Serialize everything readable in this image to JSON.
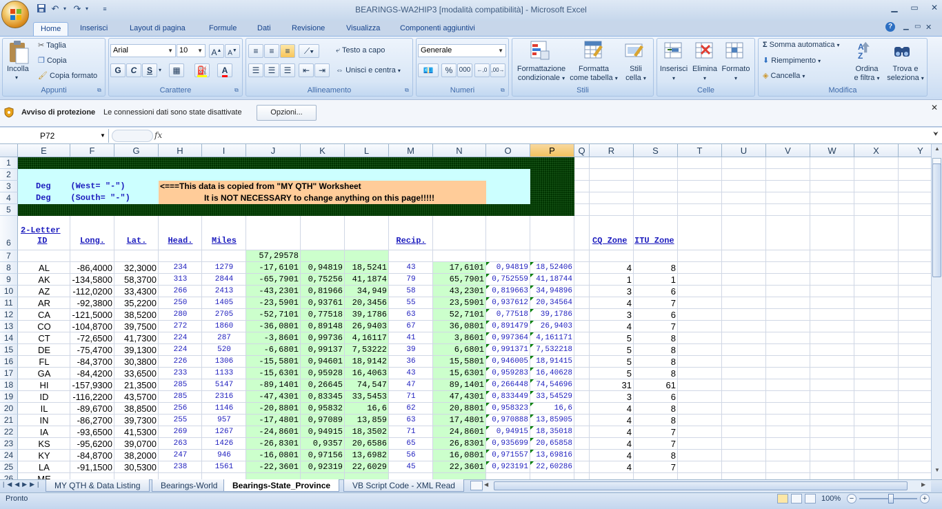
{
  "app": {
    "title": "BEARINGS-WA2HIP3  [modalità compatibilità] - Microsoft Excel"
  },
  "ribbon": {
    "tabs": [
      "Home",
      "Inserisci",
      "Layout di pagina",
      "Formule",
      "Dati",
      "Revisione",
      "Visualizza",
      "Componenti aggiuntivi"
    ],
    "clipboard": {
      "paste": "Incolla",
      "cut": "Taglia",
      "copy": "Copia",
      "format_painter": "Copia formato",
      "label": "Appunti"
    },
    "font": {
      "name": "Arial",
      "size": "10",
      "label": "Carattere",
      "bold": "G",
      "italic": "C",
      "underline": "S"
    },
    "alignment": {
      "wrap": "Testo a capo",
      "merge": "Unisci e centra",
      "label": "Allineamento"
    },
    "number": {
      "format": "Generale",
      "label": "Numeri",
      "percent": "%",
      "thousands": "000"
    },
    "styles": {
      "conditional_1": "Formattazione",
      "conditional_2": "condizionale",
      "table_1": "Formatta",
      "table_2": "come tabella",
      "cell_1": "Stili",
      "cell_2": "cella",
      "label": "Stili"
    },
    "cells": {
      "insert": "Inserisci",
      "delete": "Elimina",
      "format": "Formato",
      "label": "Celle"
    },
    "editing": {
      "autosum": "Somma automatica",
      "fill": "Riempimento",
      "clear": "Cancella",
      "sort_1": "Ordina",
      "sort_2": "e filtra",
      "find_1": "Trova e",
      "find_2": "seleziona",
      "label": "Modifica"
    }
  },
  "security_bar": {
    "title": "Avviso di protezione",
    "message": "Le connessioni dati sono state disattivate",
    "button": "Opzioni..."
  },
  "formula_bar": {
    "name_box": "P72",
    "fx": "fx"
  },
  "columns": [
    "E",
    "F",
    "G",
    "H",
    "I",
    "J",
    "K",
    "L",
    "M",
    "N",
    "O",
    "P",
    "Q",
    "R",
    "S",
    "T",
    "U",
    "V",
    "W",
    "X",
    "Y"
  ],
  "rows": [
    "1",
    "2",
    "3",
    "4",
    "5",
    "6",
    "7",
    "8",
    "9",
    "10",
    "11",
    "12",
    "13",
    "14",
    "15",
    "16",
    "17",
    "18",
    "19",
    "20",
    "21",
    "22",
    "23",
    "24",
    "25",
    "26"
  ],
  "banner": {
    "deg_west": "Deg    (West= \"-\")",
    "deg_south": "Deg    (South= \"-\")",
    "note_1": "<===This data is copied from \"MY QTH\" Worksheet",
    "note_2": "It is NOT NECESSARY to change anything on this page!!!!!"
  },
  "headers": {
    "id_1": "2-Letter",
    "id_2": "ID",
    "long": "Long.",
    "lat": "Lat.",
    "head": "Head.",
    "miles": "Miles",
    "recip": "Recip.",
    "cq": "CQ Zone",
    "itu": "ITU Zone"
  },
  "row7_j": "57,29578",
  "data_rows": [
    {
      "id": "AL",
      "long": "-86,4000",
      "lat": "32,3000",
      "head": "234",
      "miles": "1279",
      "j": "-17,6101",
      "k": "0,94819",
      "l": "18,5241",
      "m": "43",
      "n": "17,6101",
      "o": "0,94819",
      "p": "18,52406",
      "r": "4",
      "s": "8"
    },
    {
      "id": "AK",
      "long": "-134,5800",
      "lat": "58,3700",
      "head": "313",
      "miles": "2844",
      "j": "-65,7901",
      "k": "0,75256",
      "l": "41,1874",
      "m": "79",
      "n": "65,7901",
      "o": "0,752559",
      "p": "41,18744",
      "r": "1",
      "s": "1"
    },
    {
      "id": "AZ",
      "long": "-112,0200",
      "lat": "33,4300",
      "head": "266",
      "miles": "2413",
      "j": "-43,2301",
      "k": "0,81966",
      "l": "34,949",
      "m": "58",
      "n": "43,2301",
      "o": "0,819663",
      "p": "34,94896",
      "r": "3",
      "s": "6"
    },
    {
      "id": "AR",
      "long": "-92,3800",
      "lat": "35,2200",
      "head": "250",
      "miles": "1405",
      "j": "-23,5901",
      "k": "0,93761",
      "l": "20,3456",
      "m": "55",
      "n": "23,5901",
      "o": "0,937612",
      "p": "20,34564",
      "r": "4",
      "s": "7"
    },
    {
      "id": "CA",
      "long": "-121,5000",
      "lat": "38,5200",
      "head": "280",
      "miles": "2705",
      "j": "-52,7101",
      "k": "0,77518",
      "l": "39,1786",
      "m": "63",
      "n": "52,7101",
      "o": "0,77518",
      "p": "39,1786",
      "r": "3",
      "s": "6"
    },
    {
      "id": "CO",
      "long": "-104,8700",
      "lat": "39,7500",
      "head": "272",
      "miles": "1860",
      "j": "-36,0801",
      "k": "0,89148",
      "l": "26,9403",
      "m": "67",
      "n": "36,0801",
      "o": "0,891479",
      "p": "26,9403",
      "r": "4",
      "s": "7"
    },
    {
      "id": "CT",
      "long": "-72,6500",
      "lat": "41,7300",
      "head": "224",
      "miles": "287",
      "j": "-3,8601",
      "k": "0,99736",
      "l": "4,16117",
      "m": "41",
      "n": "3,8601",
      "o": "0,997364",
      "p": "4,161171",
      "r": "5",
      "s": "8"
    },
    {
      "id": "DE",
      "long": "-75,4700",
      "lat": "39,1300",
      "head": "224",
      "miles": "520",
      "j": "-6,6801",
      "k": "0,99137",
      "l": "7,53222",
      "m": "39",
      "n": "6,6801",
      "o": "0,991371",
      "p": "7,532218",
      "r": "5",
      "s": "8"
    },
    {
      "id": "FL",
      "long": "-84,3700",
      "lat": "30,3800",
      "head": "226",
      "miles": "1306",
      "j": "-15,5801",
      "k": "0,94601",
      "l": "18,9142",
      "m": "36",
      "n": "15,5801",
      "o": "0,946005",
      "p": "18,91415",
      "r": "5",
      "s": "8"
    },
    {
      "id": "GA",
      "long": "-84,4200",
      "lat": "33,6500",
      "head": "233",
      "miles": "1133",
      "j": "-15,6301",
      "k": "0,95928",
      "l": "16,4063",
      "m": "43",
      "n": "15,6301",
      "o": "0,959283",
      "p": "16,40628",
      "r": "5",
      "s": "8"
    },
    {
      "id": "HI",
      "long": "-157,9300",
      "lat": "21,3500",
      "head": "285",
      "miles": "5147",
      "j": "-89,1401",
      "k": "0,26645",
      "l": "74,547",
      "m": "47",
      "n": "89,1401",
      "o": "0,266448",
      "p": "74,54696",
      "r": "31",
      "s": "61"
    },
    {
      "id": "ID",
      "long": "-116,2200",
      "lat": "43,5700",
      "head": "285",
      "miles": "2316",
      "j": "-47,4301",
      "k": "0,83345",
      "l": "33,5453",
      "m": "71",
      "n": "47,4301",
      "o": "0,833449",
      "p": "33,54529",
      "r": "3",
      "s": "6"
    },
    {
      "id": "IL",
      "long": "-89,6700",
      "lat": "38,8500",
      "head": "256",
      "miles": "1146",
      "j": "-20,8801",
      "k": "0,95832",
      "l": "16,6",
      "m": "62",
      "n": "20,8801",
      "o": "0,958323",
      "p": "16,6",
      "r": "4",
      "s": "8"
    },
    {
      "id": "IN",
      "long": "-86,2700",
      "lat": "39,7300",
      "head": "255",
      "miles": "957",
      "j": "-17,4801",
      "k": "0,97089",
      "l": "13,859",
      "m": "63",
      "n": "17,4801",
      "o": "0,970888",
      "p": "13,85905",
      "r": "4",
      "s": "8"
    },
    {
      "id": "IA",
      "long": "-93,6500",
      "lat": "41,5300",
      "head": "269",
      "miles": "1267",
      "j": "-24,8601",
      "k": "0,94915",
      "l": "18,3502",
      "m": "71",
      "n": "24,8601",
      "o": "0,94915",
      "p": "18,35018",
      "r": "4",
      "s": "7"
    },
    {
      "id": "KS",
      "long": "-95,6200",
      "lat": "39,0700",
      "head": "263",
      "miles": "1426",
      "j": "-26,8301",
      "k": "0,9357",
      "l": "20,6586",
      "m": "65",
      "n": "26,8301",
      "o": "0,935699",
      "p": "20,65858",
      "r": "4",
      "s": "7"
    },
    {
      "id": "KY",
      "long": "-84,8700",
      "lat": "38,2000",
      "head": "247",
      "miles": "946",
      "j": "-16,0801",
      "k": "0,97156",
      "l": "13,6982",
      "m": "56",
      "n": "16,0801",
      "o": "0,971557",
      "p": "13,69816",
      "r": "4",
      "s": "8"
    },
    {
      "id": "LA",
      "long": "-91,1500",
      "lat": "30,5300",
      "head": "238",
      "miles": "1561",
      "j": "-22,3601",
      "k": "0,92319",
      "l": "22,6029",
      "m": "45",
      "n": "22,3601",
      "o": "0,923191",
      "p": "22,60286",
      "r": "4",
      "s": "7"
    }
  ],
  "sheet_tabs": [
    "MY QTH & Data Listing",
    "Bearings-World",
    "Bearings-State_Province",
    "VB Script Code - XML Read"
  ],
  "active_sheet": "Bearings-State_Province",
  "status": {
    "ready": "Pronto",
    "zoom": "100%"
  },
  "colors": {
    "banner_dark": "#003300",
    "banner_cyan": "#ccffff",
    "banner_peach": "#ffcc99",
    "light_green": "#ccffcc",
    "tri_green": "#008000"
  }
}
